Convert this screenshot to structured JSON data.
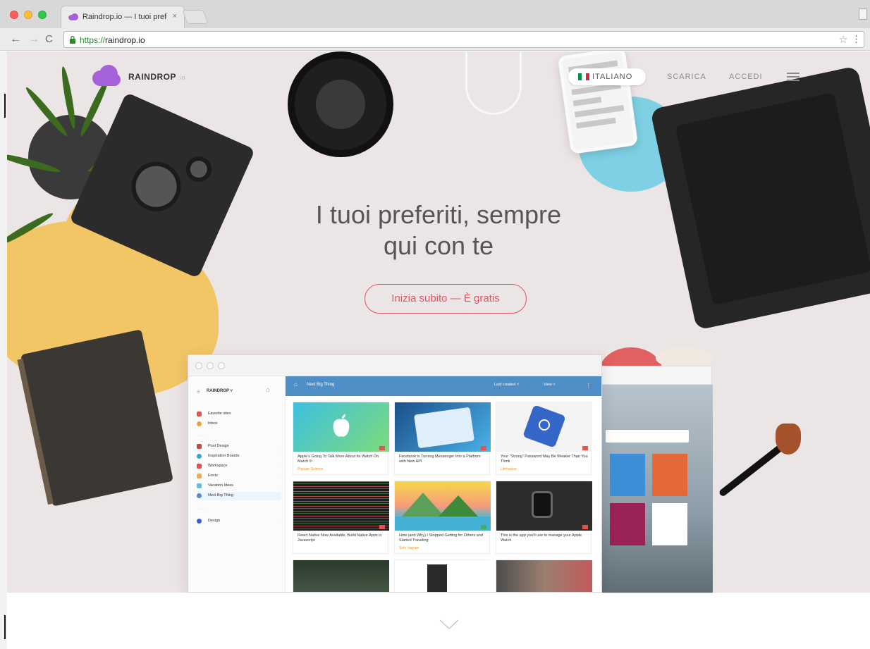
{
  "browser": {
    "tab_title": "Raindrop.io — I tuoi prefe",
    "tab_close": "×",
    "url_scheme": "https://",
    "url_host": "raindrop.io",
    "nav_back": "←",
    "nav_forward": "→",
    "nav_reload": "C",
    "bookmark_star": "☆",
    "menu": "⋮"
  },
  "site": {
    "brand": "RAINDROP",
    "brand_tld": ".io",
    "language": "ITALIANO",
    "nav": {
      "download": "SCARICA",
      "login": "ACCEDI"
    },
    "headline_line1": "I tuoi preferiti, sempre",
    "headline_line2": "qui con te",
    "cta": "Inizia subito — È gratis",
    "brand_color": "#a562d8",
    "accent_color": "#e05464"
  },
  "mockup": {
    "sidebar": {
      "brand": "RAINDROP ˅",
      "items": [
        {
          "label": "Favorite sites",
          "color": "#e25454"
        },
        {
          "label": "Inbox",
          "color": "#f4a338"
        },
        {
          "label": "Post Design",
          "color": "#c04848"
        },
        {
          "label": "Inspiration Boards",
          "color": "#3fa1d8"
        },
        {
          "label": "Workspace",
          "color": "#d9534f"
        },
        {
          "label": "Fonts",
          "color": "#f0ad4e"
        },
        {
          "label": "Vacation Ideas",
          "color": "#5bc0de"
        },
        {
          "label": "Next Big Thing",
          "color": "#4f8ec6"
        },
        {
          "label": "Design",
          "color": "#3b5bdb"
        }
      ]
    },
    "toolbar": {
      "collection": "Next Big Thing",
      "sort": "Last created ˅",
      "view": "View ˅"
    },
    "cards": [
      {
        "title": "Apple's Going To Talk More About Its Watch On March 9",
        "source": "Popular Science"
      },
      {
        "title": "Facebook is Turning Messenger Into a Platform with New API",
        "source": ""
      },
      {
        "title": "Your \"Strong\" Password May Be Weaker Than You Think",
        "source": "Lifehacker"
      },
      {
        "title": "React Native Now Available. Build Native Apps in Javascript",
        "source": ""
      },
      {
        "title": "How (and Why) I Stopped Getting for Others and Started Traveling",
        "source": "Solo Vagrant"
      },
      {
        "title": "This is the app you'll use to manage your Apple Watch",
        "source": ""
      }
    ]
  }
}
